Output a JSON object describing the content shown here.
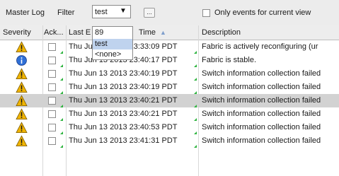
{
  "toolbar": {
    "title": "Master Log",
    "filter_label": "Filter",
    "filter_value": "test",
    "ellipsis": "...",
    "only_current_label": "Only events for current view"
  },
  "table": {
    "columns": [
      "Severity",
      "Ack...",
      "Last E",
      "Time",
      "Description"
    ],
    "rows": [
      {
        "severity": "warning",
        "time": "Thu Jun 13 2013 23:33:09 PDT",
        "desc": "Fabric is actively reconfiguring (ur"
      },
      {
        "severity": "info",
        "time": "Thu Jun 13 2013 23:40:17 PDT",
        "desc": "Fabric is stable."
      },
      {
        "severity": "warning",
        "time": "Thu Jun 13 2013 23:40:19 PDT",
        "desc": "Switch information collection failed"
      },
      {
        "severity": "warning",
        "time": "Thu Jun 13 2013 23:40:19 PDT",
        "desc": "Switch information collection failed"
      },
      {
        "severity": "warning",
        "time": "Thu Jun 13 2013 23:40:21 PDT",
        "desc": "Switch information collection failed",
        "selected": true
      },
      {
        "severity": "warning",
        "time": "Thu Jun 13 2013 23:40:21 PDT",
        "desc": "Switch information collection failed"
      },
      {
        "severity": "warning",
        "time": "Thu Jun 13 2013 23:40:53 PDT",
        "desc": "Switch information collection failed"
      },
      {
        "severity": "warning",
        "time": "Thu Jun 13 2013 23:41:31 PDT",
        "desc": "Switch information collection failed"
      }
    ]
  },
  "dropdown": {
    "options": [
      "89",
      "test",
      "<none>"
    ],
    "selected": "test"
  },
  "colors": {
    "warning": "#f0b400",
    "info": "#2f6fd6",
    "selected_row": "#d2d2d2",
    "selected_option": "#bfd3ee",
    "corner_marker": "#2bb33c"
  }
}
